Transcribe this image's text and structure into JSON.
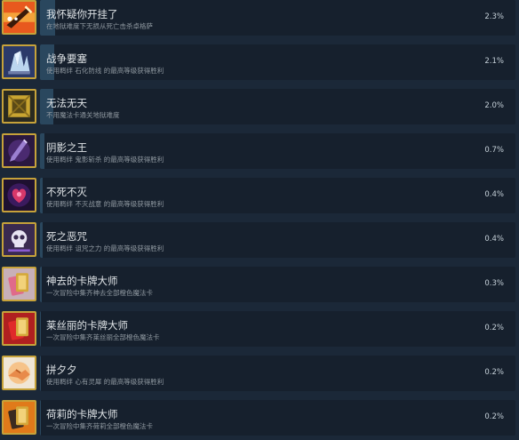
{
  "colors": {
    "background": "#1b2838",
    "panel": "#16202d",
    "progress": "#2a475e",
    "icon_border": "#c6a23a"
  },
  "achievements": [
    {
      "title": "我怀疑你开挂了",
      "description": "在地狱难度下无损从死亡击杀卓格萨",
      "percent": "2.3%",
      "icon": "sword-banner-icon",
      "fill": 0.023
    },
    {
      "title": "战争要塞",
      "description": "使用羁绊 石化防线 的最高等级获得胜利",
      "percent": "2.1%",
      "icon": "crystal-fortress-icon",
      "fill": 0.021
    },
    {
      "title": "无法无天",
      "description": "不用魔法卡通关地狱难度",
      "percent": "2.0%",
      "icon": "golden-frame-icon",
      "fill": 0.02
    },
    {
      "title": "阴影之王",
      "description": "使用羁绊 鬼影斩杀 的最高等级获得胜利",
      "percent": "0.7%",
      "icon": "shadow-dagger-icon",
      "fill": 0.007
    },
    {
      "title": "不死不灭",
      "description": "使用羁绊 不灭战意 的最高等级获得胜利",
      "percent": "0.4%",
      "icon": "undying-heart-icon",
      "fill": 0.004
    },
    {
      "title": "死之恶咒",
      "description": "使用羁绊 诅咒之力 的最高等级获得胜利",
      "percent": "0.4%",
      "icon": "skull-curse-icon",
      "fill": 0.004
    },
    {
      "title": "神去的卡牌大师",
      "description": "一次冒险中集齐神去全部橙色魔法卡",
      "percent": "0.3%",
      "icon": "card-pink-icon",
      "fill": 0.003
    },
    {
      "title": "莱丝丽的卡牌大师",
      "description": "一次冒险中集齐莱丝丽全部橙色魔法卡",
      "percent": "0.2%",
      "icon": "card-red-icon",
      "fill": 0.002
    },
    {
      "title": "拼夕夕",
      "description": "使用羁绊 心有灵犀 的最高等级获得胜利",
      "percent": "0.2%",
      "icon": "handshake-icon",
      "fill": 0.002
    },
    {
      "title": "荷莉的卡牌大师",
      "description": "一次冒险中集齐荷莉全部橙色魔法卡",
      "percent": "0.2%",
      "icon": "card-orange-icon",
      "fill": 0.002
    }
  ]
}
